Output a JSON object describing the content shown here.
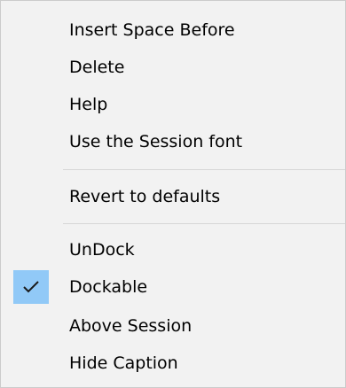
{
  "menu": {
    "items": [
      {
        "label": "Insert Space Before"
      },
      {
        "label": "Delete"
      },
      {
        "label": "Help"
      },
      {
        "label": "Use the Session font"
      },
      {
        "label": "Revert to defaults"
      },
      {
        "label": "UnDock"
      },
      {
        "label": "Dockable",
        "checked": true
      },
      {
        "label": "Above Session"
      },
      {
        "label": "Hide Caption"
      }
    ],
    "check_icon": "checkmark-icon",
    "check_highlight_color": "#91c9f7"
  }
}
